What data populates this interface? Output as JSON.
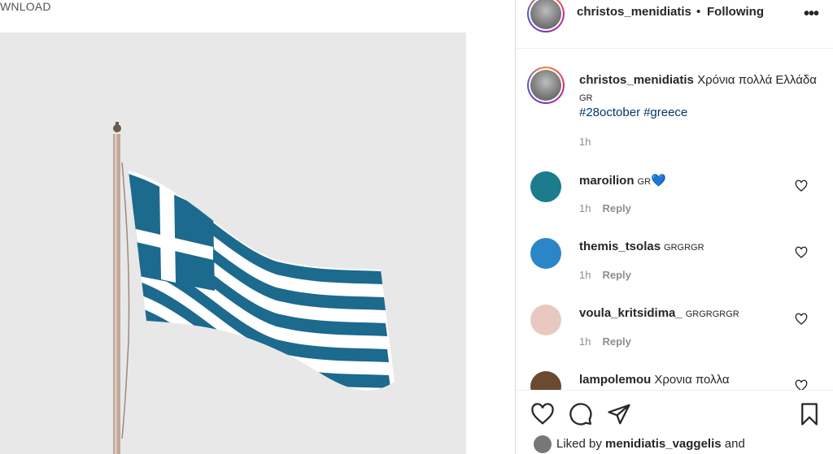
{
  "top_label": "WNLOAD",
  "post": {
    "header": {
      "username": "christos_menidiatis",
      "separator": "•",
      "following_label": "Following",
      "more_icon": "more-horizontal-icon",
      "more_glyph": "•••"
    },
    "caption": {
      "username": "christos_menidiatis",
      "text": "Χρόνια πολλά Ελλάδα",
      "flag_code": "GR",
      "hashtags": [
        "#28october",
        "#greece"
      ],
      "time": "1h"
    },
    "comments": [
      {
        "username": "maroilion",
        "text": "GR",
        "emoji": "💙",
        "time": "1h",
        "reply": "Reply",
        "avatar_color": "#1a7c8c"
      },
      {
        "username": "themis_tsolas",
        "text": "GRGRGR",
        "time": "1h",
        "reply": "Reply",
        "avatar_color": "#2a86c7"
      },
      {
        "username": "voula_kritsidima_",
        "text": "GRGRGRGR",
        "time": "1h",
        "reply": "Reply",
        "avatar_color": "#e8c8c0"
      },
      {
        "username": "lampolemou",
        "text": "Χρονια πολλα",
        "avatar_color": "#6b4a32"
      }
    ],
    "actions": {
      "like_icon": "heart-icon",
      "comment_icon": "comment-icon",
      "share_icon": "send-icon",
      "save_icon": "bookmark-icon",
      "liked_prefix": "Liked by",
      "liked_user": "menidiatis_vaggelis",
      "liked_suffix": "and"
    },
    "colors": {
      "flag_blue": "#1c6a8e",
      "hashtag": "#00376b",
      "heart_blue": "#3b82f6"
    }
  }
}
